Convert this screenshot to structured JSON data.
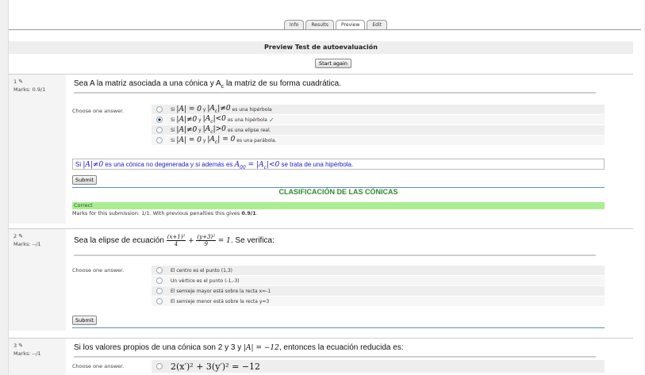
{
  "tabs": [
    "Info",
    "Results",
    "Preview",
    "Edit"
  ],
  "header": {
    "title": "Preview Test de autoevaluación",
    "restart_label": "Start again"
  },
  "q1": {
    "number": "1",
    "marks": "Marks: 0.9/1",
    "text_prefix": "Sea A la matriz asociada a una cónica y A",
    "text_sub": "c",
    "text_suffix": " la matriz de su forma cuadrática.",
    "choose_label": "Choose one answer.",
    "answers": [
      {
        "word_si": "Si",
        "m1": "|A| = 0",
        "word_y": "y",
        "m2": "|A",
        "m2sub": "c",
        "m2rest": "|≠0",
        "text": "es una hipérbola"
      },
      {
        "word_si": "Si",
        "m1": "|A|≠0",
        "word_y": "y",
        "m2": "|A",
        "m2sub": "c",
        "m2rest": "|<0",
        "text": "es una hipérbola",
        "mark": "✓"
      },
      {
        "word_si": "Si",
        "m1": "|A|≠0",
        "word_y": "y",
        "m2": "|A",
        "m2sub": "c",
        "m2rest": "|>0",
        "text": "es una elipse real."
      },
      {
        "word_si": "Si",
        "m1": "|A| = 0",
        "word_y": "y",
        "m2": "|A",
        "m2sub": "c",
        "m2rest": "| = 0",
        "text": "es una parábola."
      }
    ],
    "feedback": {
      "t1": "Si ",
      "m1": "|A|≠0",
      "t2": " es una cónica no degenerada y si además es ",
      "m2": "A",
      "m2sub": "00",
      "m2rest": " = |A",
      "m3sub": "c",
      "m3rest": "|<0",
      "t3": " se trata de una hipérbola."
    },
    "submit_label": "Submit",
    "section_title": "CLASIFICACIÓN DE LAS CÓNICAS",
    "correct_label": "Correct",
    "marks_line_prefix": "Marks for this submission: 1/1. With previous penalties this gives ",
    "marks_line_value": "0.9/1",
    "marks_line_suffix": "."
  },
  "q2": {
    "number": "2",
    "marks": "Marks: --/1",
    "text_prefix": "Sea la elipse de ecuación ",
    "frac1_num": "(x+1)²",
    "frac1_den": "4",
    "plus": "+",
    "frac2_num": "(y+3)²",
    "frac2_den": "9",
    "equals": "= 1",
    "text_suffix": ". Se verifica:",
    "choose_label": "Choose one answer.",
    "answers": [
      "El centro es el punto (1,3)",
      "Un vértice es el punto (-1,-3)",
      "El semieje mayor está sobre la recta x=-1",
      "El semieje menor está sobre la recta y=3"
    ],
    "submit_label": "Submit"
  },
  "q3": {
    "number": "3",
    "marks": "Marks: --/1",
    "text_prefix": "Si los valores propios de una cónica son 2 y 3 y ",
    "text_math": "|A| = −12",
    "text_suffix": ", entonces la ecuación reducida es:",
    "choose_label": "Choose one answer.",
    "answers": [
      "2(x′)² + 3(y′)² = −12"
    ]
  }
}
